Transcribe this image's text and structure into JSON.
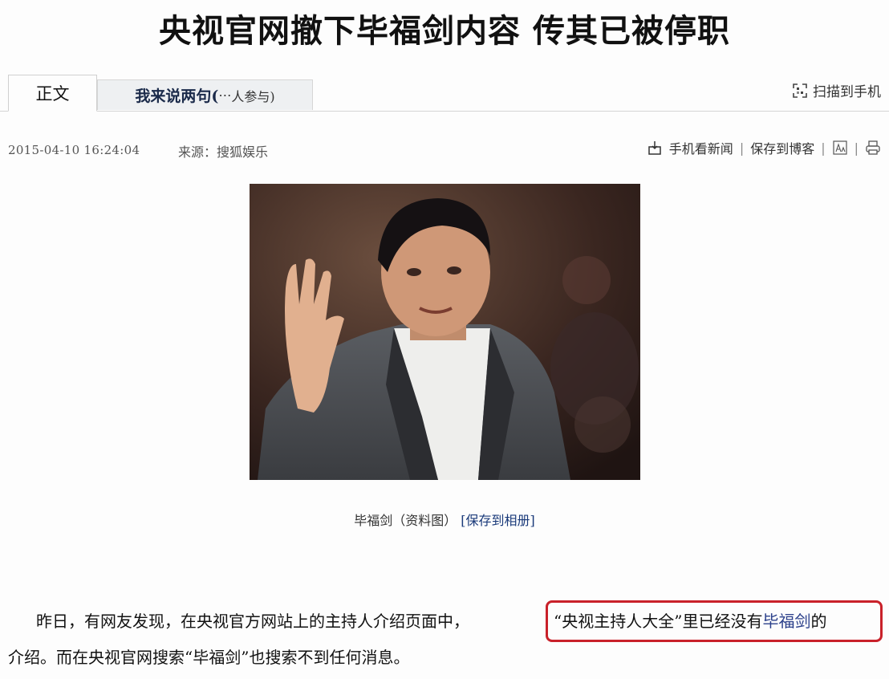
{
  "article": {
    "headline": "央视官网撤下毕福剑内容 传其已被停职",
    "tabs": {
      "main": "正文",
      "comment": "我来说两句(",
      "comment_suffix": "人参与)"
    },
    "scan_to_phone": "扫描到手机",
    "date": "2015-04-10 16:24:04",
    "source": "来源：搜狐娱乐",
    "tools": {
      "mobile_news": "手机看新闻",
      "save_blog": "保存到博客"
    },
    "image_caption": "毕福剑（资料图）",
    "save_album": "[保存到相册]",
    "para1_start": "昨日，有网友发现，在央视官方网站上的主持人介绍页面中，",
    "para1_highlight_a": "“央视主持人大全”里已经没有",
    "para1_highlight_link": "毕福剑",
    "para1_highlight_b": "的",
    "para2": "介绍。而在央视官网搜索“毕福剑”也搜索不到任何消息。"
  },
  "colors": {
    "highlight_border": "#c9212a",
    "link": "#2a3f8a",
    "tab_bg": "#eef0f2"
  },
  "icons": [
    "qr-scan-icon",
    "mobile-icon",
    "font-size-icon",
    "print-icon"
  ]
}
